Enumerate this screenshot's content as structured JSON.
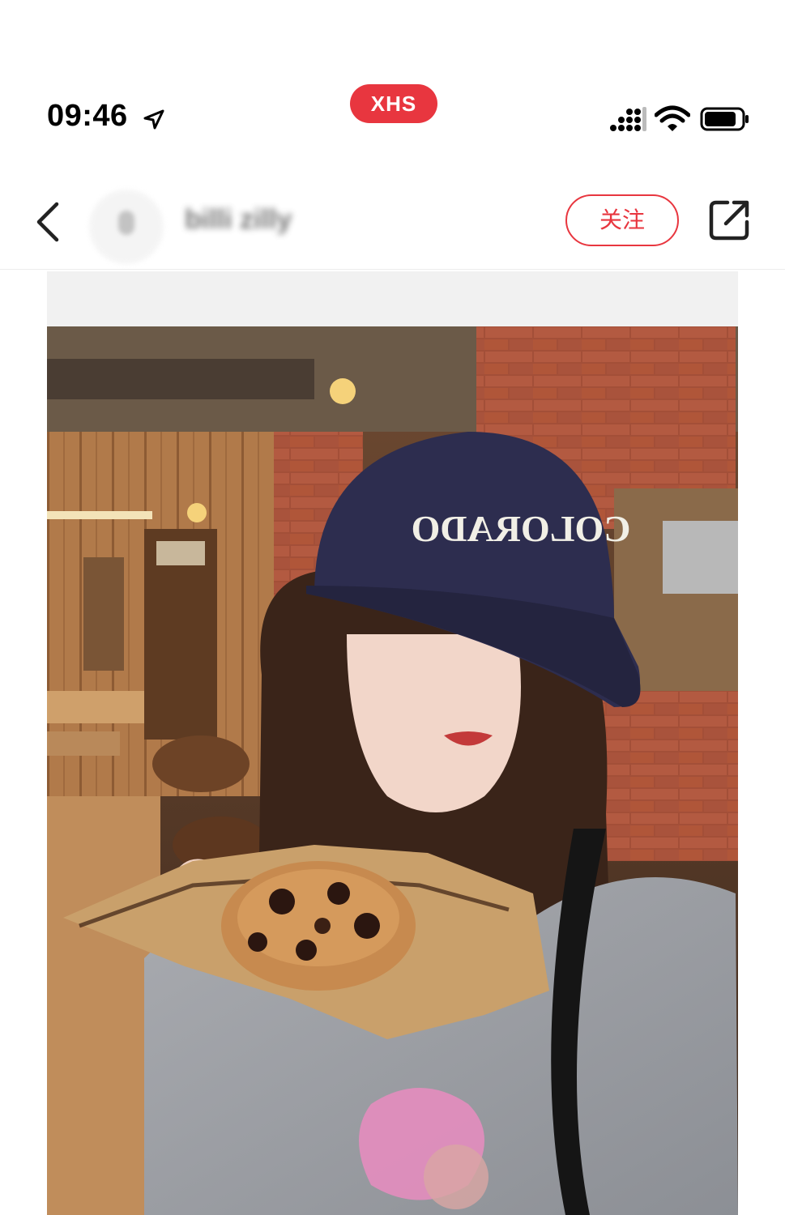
{
  "status_bar": {
    "time": "09:46",
    "location_icon": "location-arrow-icon",
    "badge": "XHS",
    "signal_icon": "cellular-signal-icon",
    "wifi_icon": "wifi-icon",
    "battery_icon": "battery-icon"
  },
  "nav": {
    "back_icon": "chevron-left-icon",
    "username": "billi zilly",
    "follow_label": "关注",
    "share_icon": "share-external-icon"
  },
  "post": {
    "cap_text": "COLORADO",
    "colors": {
      "accent": "#e8363f",
      "cap": "#2d2d4f",
      "brick": "#9c4a34",
      "wood": "#b07a4a"
    }
  }
}
